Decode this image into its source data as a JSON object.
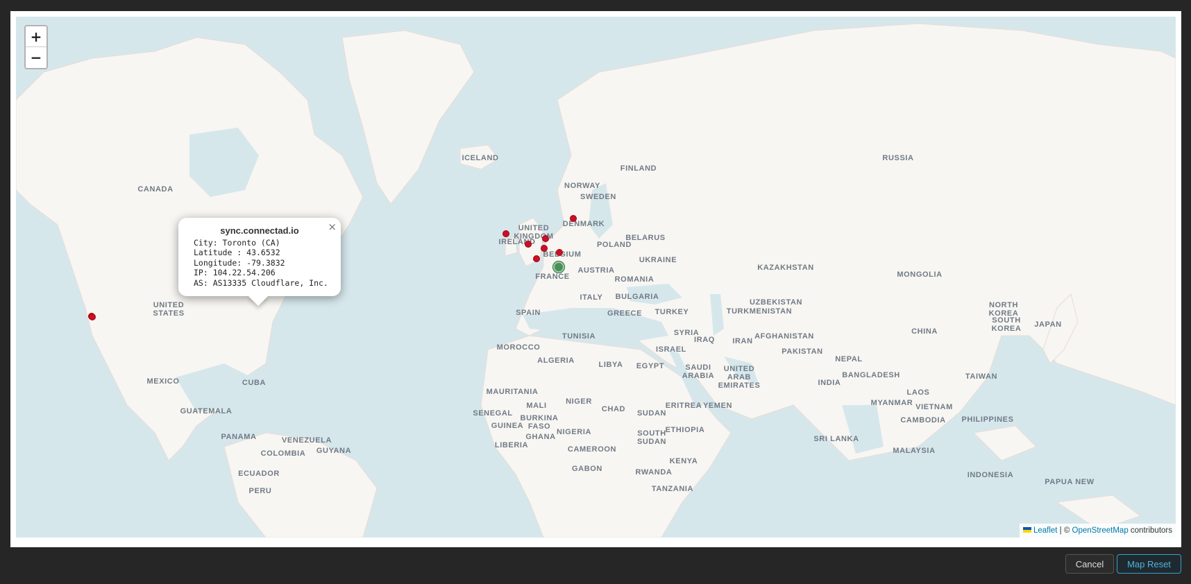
{
  "map": {
    "zoom_in_label": "+",
    "zoom_out_label": "−",
    "country_labels": [
      {
        "name": "CANADA",
        "text": "CANADA"
      },
      {
        "name": "UNITED STATES",
        "text": "UNITED\nSTATES"
      },
      {
        "name": "MEXICO",
        "text": "MEXICO"
      },
      {
        "name": "CUBA",
        "text": "CUBA"
      },
      {
        "name": "GUATEMALA",
        "text": "GUATEMALA"
      },
      {
        "name": "PANAMA",
        "text": "PANAMA"
      },
      {
        "name": "VENEZUELA",
        "text": "VENEZUELA"
      },
      {
        "name": "COLOMBIA",
        "text": "COLOMBIA"
      },
      {
        "name": "GUYANA",
        "text": "GUYANA"
      },
      {
        "name": "ECUADOR",
        "text": "ECUADOR"
      },
      {
        "name": "PERU",
        "text": "PERU"
      },
      {
        "name": "ICELAND",
        "text": "ICELAND"
      },
      {
        "name": "UNITED KINGDOM",
        "text": "UNITED\nKINGDOM"
      },
      {
        "name": "IRELAND",
        "text": "IRELAND"
      },
      {
        "name": "NORWAY",
        "text": "NORWAY"
      },
      {
        "name": "SWEDEN",
        "text": "SWEDEN"
      },
      {
        "name": "FINLAND",
        "text": "FINLAND"
      },
      {
        "name": "DENMARK",
        "text": "DENMARK"
      },
      {
        "name": "BELGIUM",
        "text": "BELGIUM"
      },
      {
        "name": "FRANCE",
        "text": "FRANCE"
      },
      {
        "name": "AUSTRIA",
        "text": "AUSTRIA"
      },
      {
        "name": "POLAND",
        "text": "POLAND"
      },
      {
        "name": "BELARUS",
        "text": "BELARUS"
      },
      {
        "name": "UKRAINE",
        "text": "UKRAINE"
      },
      {
        "name": "ROMANIA",
        "text": "ROMANIA"
      },
      {
        "name": "BULGARIA",
        "text": "BULGARIA"
      },
      {
        "name": "SPAIN",
        "text": "SPAIN"
      },
      {
        "name": "ITALY",
        "text": "ITALY"
      },
      {
        "name": "GREECE",
        "text": "GREECE"
      },
      {
        "name": "TURKEY",
        "text": "TURKEY"
      },
      {
        "name": "RUSSIA",
        "text": "RUSSIA"
      },
      {
        "name": "KAZAKHSTAN",
        "text": "KAZAKHSTAN"
      },
      {
        "name": "MONGOLIA",
        "text": "MONGOLIA"
      },
      {
        "name": "UZBEKISTAN",
        "text": "UZBEKISTAN"
      },
      {
        "name": "TURKMENISTAN",
        "text": "TURKMENISTAN"
      },
      {
        "name": "SYRIA",
        "text": "SYRIA"
      },
      {
        "name": "IRAQ",
        "text": "IRAQ"
      },
      {
        "name": "IRAN",
        "text": "IRAN"
      },
      {
        "name": "AFGHANISTAN",
        "text": "AFGHANISTAN"
      },
      {
        "name": "PAKISTAN",
        "text": "PAKISTAN"
      },
      {
        "name": "NEPAL",
        "text": "NEPAL"
      },
      {
        "name": "CHINA",
        "text": "CHINA"
      },
      {
        "name": "NORTH KOREA",
        "text": "NORTH\nKOREA"
      },
      {
        "name": "SOUTH KOREA",
        "text": "SOUTH\nKOREA"
      },
      {
        "name": "JAPAN",
        "text": "JAPAN"
      },
      {
        "name": "TAIWAN",
        "text": "TAIWAN"
      },
      {
        "name": "INDIA",
        "text": "INDIA"
      },
      {
        "name": "BANGLADESH",
        "text": "BANGLADESH"
      },
      {
        "name": "MYANMAR",
        "text": "MYANMAR"
      },
      {
        "name": "LAOS",
        "text": "LAOS"
      },
      {
        "name": "VIETNAM",
        "text": "VIETNAM"
      },
      {
        "name": "CAMBODIA",
        "text": "CAMBODIA"
      },
      {
        "name": "PHILIPPINES",
        "text": "PHILIPPINES"
      },
      {
        "name": "SRI LANKA",
        "text": "SRI LANKA"
      },
      {
        "name": "MALAYSIA",
        "text": "MALAYSIA"
      },
      {
        "name": "INDONESIA",
        "text": "INDONESIA"
      },
      {
        "name": "PAPUA NEW GUINEA",
        "text": "PAPUA NEW"
      },
      {
        "name": "ISRAEL",
        "text": "ISRAEL"
      },
      {
        "name": "SAUDI ARABIA",
        "text": "SAUDI\nARABIA"
      },
      {
        "name": "UNITED ARAB EMIRATES",
        "text": "UNITED\nARAB\nEMIRATES"
      },
      {
        "name": "YEMEN",
        "text": "YEMEN"
      },
      {
        "name": "EGYPT",
        "text": "EGYPT"
      },
      {
        "name": "LIBYA",
        "text": "LIBYA"
      },
      {
        "name": "TUNISIA",
        "text": "TUNISIA"
      },
      {
        "name": "ALGERIA",
        "text": "ALGERIA"
      },
      {
        "name": "MOROCCO",
        "text": "MOROCCO"
      },
      {
        "name": "MAURITANIA",
        "text": "MAURITANIA"
      },
      {
        "name": "MALI",
        "text": "MALI"
      },
      {
        "name": "NIGER",
        "text": "NIGER"
      },
      {
        "name": "CHAD",
        "text": "CHAD"
      },
      {
        "name": "SUDAN",
        "text": "SUDAN"
      },
      {
        "name": "ERITREA",
        "text": "ERITREA"
      },
      {
        "name": "ETHIOPIA",
        "text": "ETHIOPIA"
      },
      {
        "name": "SENEGAL",
        "text": "SENEGAL"
      },
      {
        "name": "GUINEA",
        "text": "GUINEA"
      },
      {
        "name": "BURKINA FASO",
        "text": "BURKINA\nFASO"
      },
      {
        "name": "GHANA",
        "text": "GHANA"
      },
      {
        "name": "LIBERIA",
        "text": "LIBERIA"
      },
      {
        "name": "NIGERIA",
        "text": "NIGERIA"
      },
      {
        "name": "CAMEROON",
        "text": "CAMEROON"
      },
      {
        "name": "SOUTH SUDAN",
        "text": "SOUTH\nSUDAN"
      },
      {
        "name": "GABON",
        "text": "GABON"
      },
      {
        "name": "KENYA",
        "text": "KENYA"
      },
      {
        "name": "RWANDA",
        "text": "RWANDA"
      },
      {
        "name": "TANZANIA",
        "text": "TANZANIA"
      }
    ],
    "markers": [
      {
        "name": "marker-toronto",
        "lat": 43.6532,
        "lon": -79.3832
      },
      {
        "name": "marker-california-1",
        "lat": 37.4,
        "lon": -122.1
      },
      {
        "name": "marker-california-2",
        "lat": 37.3,
        "lon": -121.9
      },
      {
        "name": "marker-ireland",
        "lat": 53.3,
        "lon": -6.3
      },
      {
        "name": "marker-london",
        "lat": 51.5,
        "lon": -0.1
      },
      {
        "name": "marker-amsterdam",
        "lat": 52.4,
        "lon": 4.9
      },
      {
        "name": "marker-brussels",
        "lat": 50.8,
        "lon": 4.4
      },
      {
        "name": "marker-paris",
        "lat": 48.9,
        "lon": 2.3
      },
      {
        "name": "marker-germany",
        "lat": 50.1,
        "lon": 8.7
      },
      {
        "name": "marker-denmark",
        "lat": 55.7,
        "lon": 12.6
      }
    ],
    "home_marker": {
      "lat": 47.4,
      "lon": 8.5
    }
  },
  "popup": {
    "title": "sync.connectad.io",
    "close_label": "×",
    "lines": [
      "City: Toronto (CA)",
      "Latitude : 43.6532",
      "Longitude: -79.3832",
      "IP: 104.22.54.206",
      "AS: AS13335 Cloudflare, Inc."
    ]
  },
  "attribution": {
    "leaflet": "Leaflet",
    "separator": " | © ",
    "osm": "OpenStreetMap",
    "suffix": " contributors"
  },
  "footer": {
    "cancel_label": "Cancel",
    "reset_label": "Map Reset"
  },
  "colors": {
    "water": "#d6e7ec",
    "land": "#f8f6f2",
    "marker": "#c8102e",
    "home_marker": "#4a8f5a",
    "accent": "#3aa0c8"
  }
}
